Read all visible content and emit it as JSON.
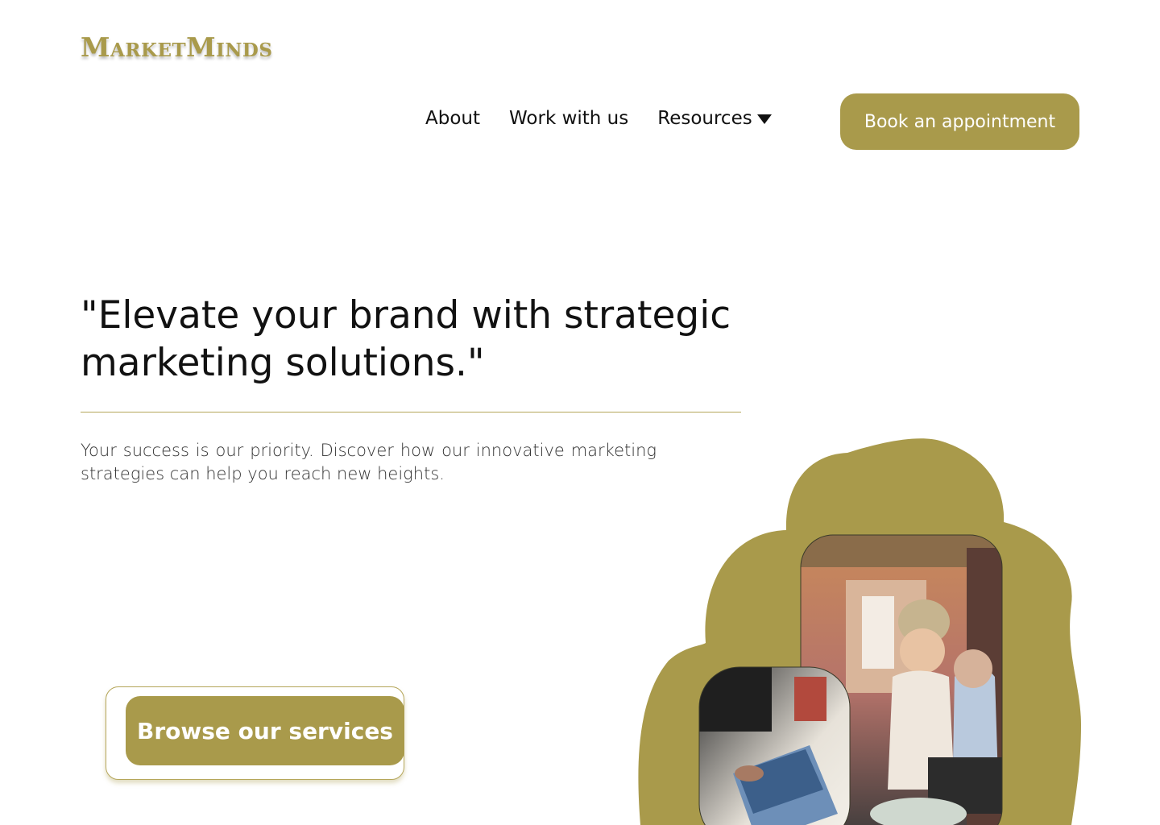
{
  "brand": {
    "name": "MarketMinds",
    "color": "#a99a4b"
  },
  "nav": {
    "about": "About",
    "work": "Work with us",
    "resources": "Resources"
  },
  "cta": {
    "book": "Book an appointment",
    "browse": "Browse our services"
  },
  "hero": {
    "headline": "\"Elevate your brand with strategic marketing solutions.\"",
    "subtext": "Your success is our priority. Discover how our innovative marketing strategies can help you reach new heights."
  },
  "icons": {
    "resources_dropdown": "caret-down-icon"
  }
}
